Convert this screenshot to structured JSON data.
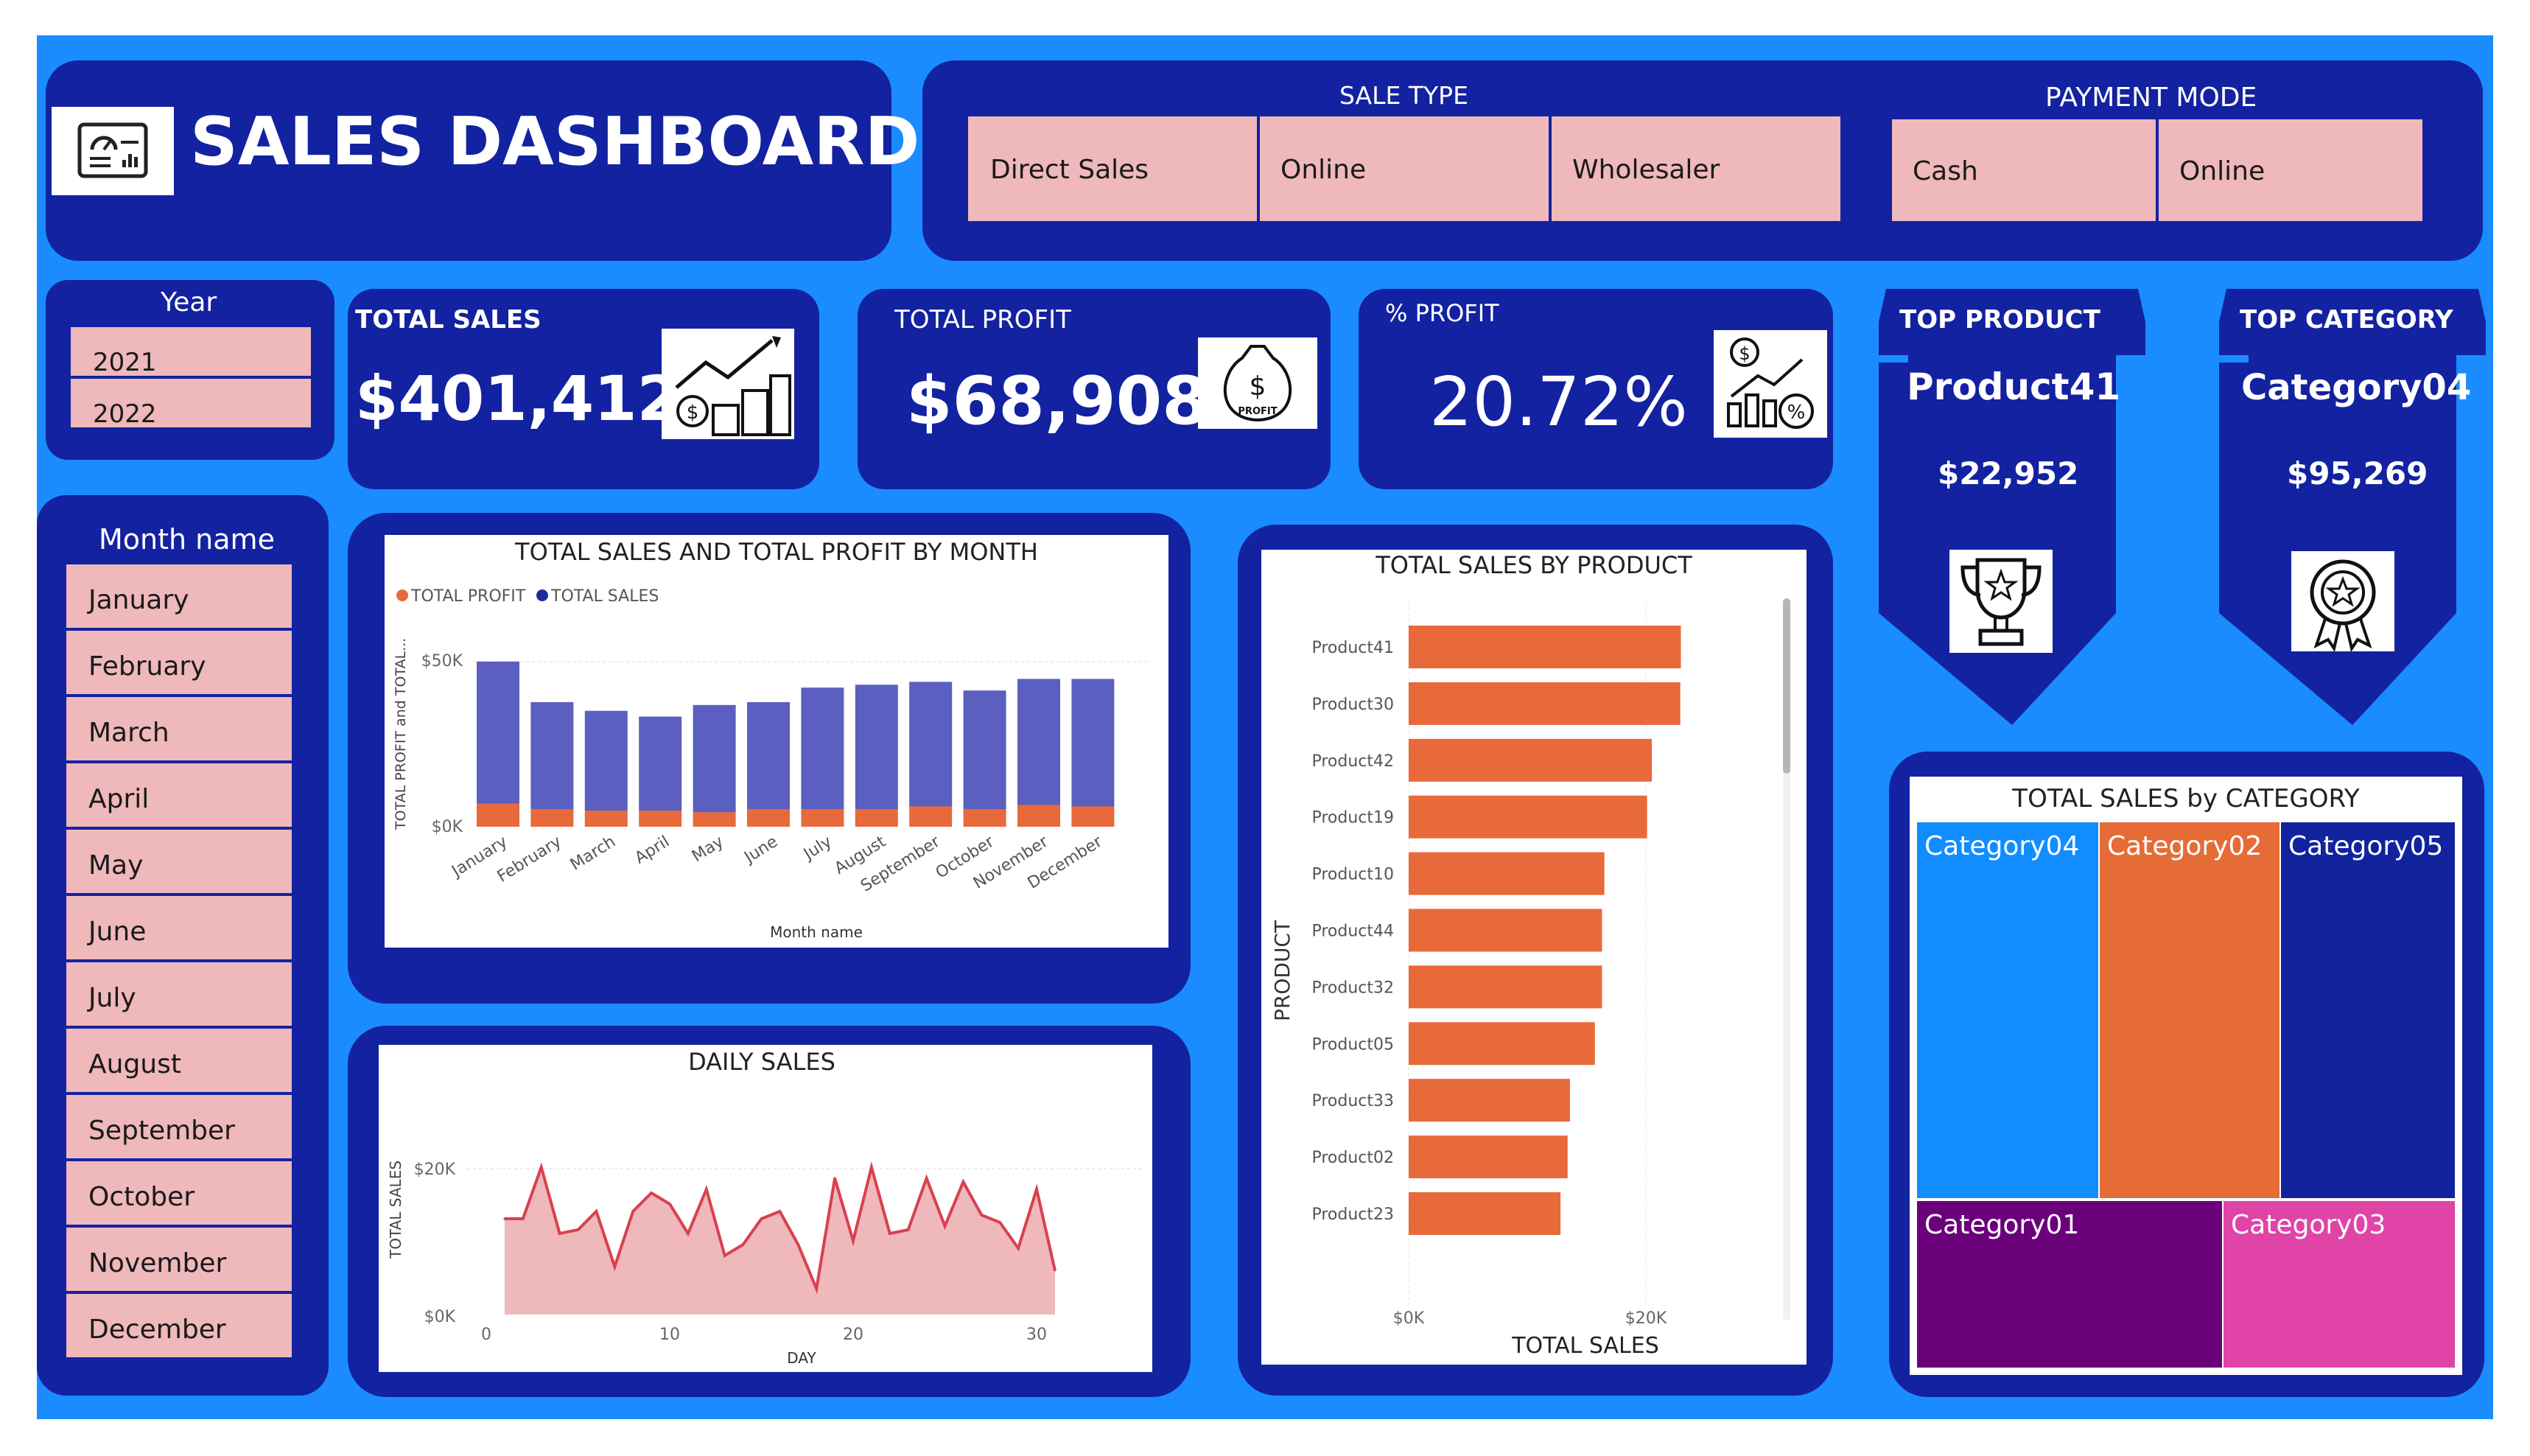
{
  "header": {
    "title": "SALES DASHBOARD",
    "icon": "dashboard-icon"
  },
  "sale_type": {
    "label": "SALE TYPE",
    "options": [
      "Direct Sales",
      "Online",
      "Wholesaler"
    ]
  },
  "payment_mode": {
    "label": "PAYMENT MODE",
    "options": [
      "Cash",
      "Online"
    ]
  },
  "year_filter": {
    "label": "Year",
    "options": [
      "2021",
      "2022"
    ]
  },
  "month_filter": {
    "label": "Month name",
    "options": [
      "January",
      "February",
      "March",
      "April",
      "May",
      "June",
      "July",
      "August",
      "September",
      "October",
      "November",
      "December"
    ]
  },
  "kpis": {
    "total_sales": {
      "label": "TOTAL SALES",
      "value": "$401,412",
      "icon": "coins-growth-icon"
    },
    "total_profit": {
      "label": "TOTAL PROFIT",
      "value": "$68,908",
      "icon": "money-bag-icon",
      "icon_text": "PROFIT"
    },
    "pct_profit": {
      "label": "% PROFIT",
      "value": "20.72%",
      "icon": "percent-chart-icon"
    }
  },
  "top_product": {
    "label": "TOP PRODUCT",
    "name": "Product41",
    "value": "$22,952",
    "icon": "trophy-icon"
  },
  "top_category": {
    "label": "TOP CATEGORY",
    "name": "Category04",
    "value": "$95,269",
    "icon": "award-badge-icon"
  },
  "colors": {
    "background": "#1a8cff",
    "card": "#1322a0",
    "pink": "#efb8bb",
    "orange": "#e8693a",
    "purple_bar": "#5a5fc0",
    "line": "#d9414f"
  },
  "chart_data": [
    {
      "type": "bar",
      "title": "TOTAL SALES AND TOTAL PROFIT BY MONTH",
      "xlabel": "Month name",
      "ylabel": "TOTAL PROFIT and TOTAL...",
      "ticks": [
        "$50K",
        "$0K"
      ],
      "categories": [
        "January",
        "February",
        "March",
        "April",
        "May",
        "June",
        "July",
        "August",
        "September",
        "October",
        "November",
        "December"
      ],
      "series": [
        {
          "name": "TOTAL PROFIT",
          "values": [
            8000,
            6000,
            5500,
            5500,
            5000,
            6000,
            6000,
            6000,
            7000,
            6000,
            7500,
            7000
          ]
        },
        {
          "name": "TOTAL SALES",
          "values": [
            57000,
            43000,
            40000,
            38000,
            42000,
            43000,
            48000,
            49000,
            50000,
            47000,
            51000,
            51000
          ]
        }
      ],
      "ylim": [
        0,
        60000
      ],
      "legend": "top-left"
    },
    {
      "type": "area",
      "title": "DAILY SALES",
      "xlabel": "DAY",
      "ylabel": "TOTAL SALES",
      "yticks": [
        "$20K",
        "$0K"
      ],
      "xticks": [
        "0",
        "10",
        "20",
        "30"
      ],
      "x": [
        1,
        2,
        3,
        4,
        5,
        6,
        7,
        8,
        9,
        10,
        11,
        12,
        13,
        14,
        15,
        16,
        17,
        18,
        19,
        20,
        21,
        22,
        23,
        24,
        25,
        26,
        27,
        28,
        29,
        30,
        31
      ],
      "values": [
        13000,
        13000,
        20000,
        11000,
        11500,
        14000,
        6500,
        14000,
        16500,
        15000,
        11000,
        17000,
        8000,
        9500,
        13000,
        14000,
        9500,
        3500,
        18500,
        10000,
        20000,
        11000,
        11500,
        18500,
        12000,
        18000,
        13500,
        12500,
        9000,
        17000,
        6000
      ],
      "ylim": [
        0,
        25000
      ],
      "xlim": [
        0,
        34
      ]
    },
    {
      "type": "bar",
      "orientation": "horizontal",
      "title": "TOTAL SALES BY PRODUCT",
      "xlabel": "TOTAL SALES",
      "ylabel": "PRODUCT",
      "xticks": [
        "$0K",
        "$20K"
      ],
      "categories": [
        "Product41",
        "Product30",
        "Product42",
        "Product19",
        "Product10",
        "Product44",
        "Product32",
        "Product05",
        "Product33",
        "Product02",
        "Product23"
      ],
      "values": [
        22952,
        22900,
        20500,
        20100,
        16500,
        16300,
        16300,
        15700,
        13600,
        13400,
        12800
      ],
      "xlim": [
        0,
        32000
      ]
    },
    {
      "type": "heatmap",
      "subtype": "treemap",
      "title": "TOTAL SALES by CATEGORY",
      "categories": [
        "Category04",
        "Category02",
        "Category05",
        "Category01",
        "Category03"
      ],
      "values": [
        95269,
        89000,
        84000,
        72000,
        61000
      ],
      "colors": [
        "#118dff",
        "#e66c37",
        "#12239e",
        "#6b007b",
        "#e044a7"
      ]
    }
  ]
}
